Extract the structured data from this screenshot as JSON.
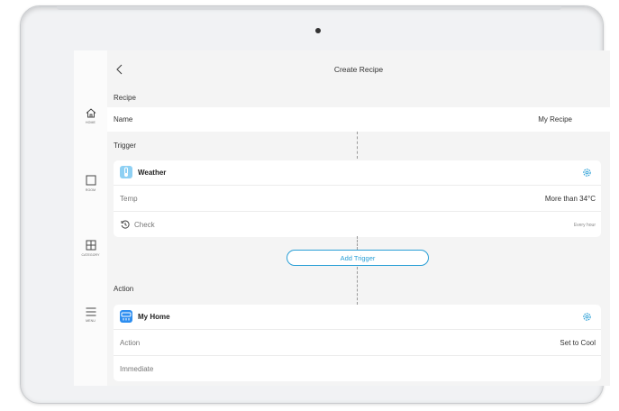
{
  "header": {
    "title": "Create Recipe"
  },
  "sidebar": {
    "items": [
      {
        "label": "HOME",
        "icon": "home-icon"
      },
      {
        "label": "ROOM",
        "icon": "room-icon"
      },
      {
        "label": "CATEGORY",
        "icon": "category-icon"
      },
      {
        "label": "MENU",
        "icon": "menu-icon"
      }
    ]
  },
  "recipe": {
    "section": "Recipe",
    "name_label": "Name",
    "name_value": "My Recipe"
  },
  "trigger": {
    "section": "Trigger",
    "card_title": "Weather",
    "rows": [
      {
        "label": "Temp",
        "value": "More than 34°C"
      },
      {
        "label": "Check",
        "value": "Every hour"
      }
    ],
    "add_label": "Add Trigger"
  },
  "action": {
    "section": "Action",
    "card_title": "My Home",
    "rows": [
      {
        "label": "Action",
        "value": "Set to Cool"
      },
      {
        "label": "Immediate",
        "value": ""
      }
    ]
  },
  "colors": {
    "accent": "#2a9fd6",
    "weather_icon": "#8ed0f3",
    "home_icon": "#2d8ef0"
  }
}
